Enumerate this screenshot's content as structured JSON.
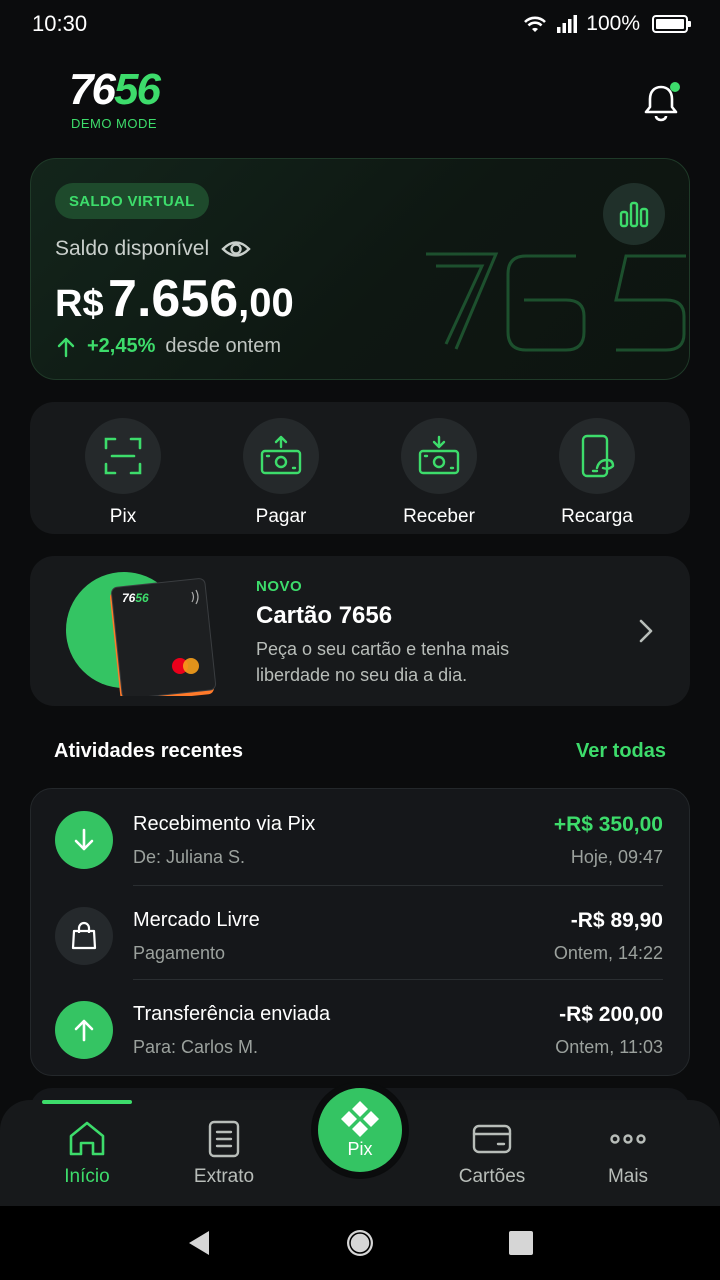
{
  "status_bar": {
    "time": "10:30",
    "battery": "100%"
  },
  "header": {
    "logo_white": "76",
    "logo_green": "56",
    "logo_sub": "DEMO MODE"
  },
  "balance": {
    "badge": "SALDO VIRTUAL",
    "label": "Saldo disponível",
    "currency": "R$",
    "integer": "7.656",
    "decimal": ",00",
    "change": "+2,45%",
    "since": "desde ontem"
  },
  "actions": [
    {
      "label": "Pix",
      "icon": "pix-scan-icon"
    },
    {
      "label": "Pagar",
      "icon": "pay-money-icon"
    },
    {
      "label": "Receber",
      "icon": "receive-money-icon"
    },
    {
      "label": "Recarga",
      "icon": "phone-recharge-icon"
    }
  ],
  "promo": {
    "tag": "NOVO",
    "title": "Cartão 7656",
    "description": "Peça o seu cartão e tenha mais liberdade no seu dia a dia.",
    "card_logo": "7656"
  },
  "activities": {
    "title": "Atividades recentes",
    "see_all": "Ver todas",
    "items": [
      {
        "name": "Recebimento via Pix",
        "sub": "De: Juliana S.",
        "amount": "+R$ 350,00",
        "time": "Hoje, 09:47",
        "icon": "arrow-down-icon",
        "positive": true
      },
      {
        "name": "Mercado Livre",
        "sub": "Pagamento",
        "amount": "-R$ 89,90",
        "time": "Ontem, 14:22",
        "icon": "shopping-bag-icon",
        "positive": false
      },
      {
        "name": "Transferência enviada",
        "sub": "Para: Carlos M.",
        "amount": "-R$ 200,00",
        "time": "Ontem, 11:03",
        "icon": "arrow-up-icon",
        "positive": false
      }
    ]
  },
  "nav": {
    "home": "Início",
    "statement": "Extrato",
    "pix": "Pix",
    "cards": "Cartões",
    "more": "Mais",
    "active": "home"
  },
  "colors": {
    "accent": "#3ddc6b",
    "background": "#0b0c0d",
    "surface": "#17191b"
  }
}
